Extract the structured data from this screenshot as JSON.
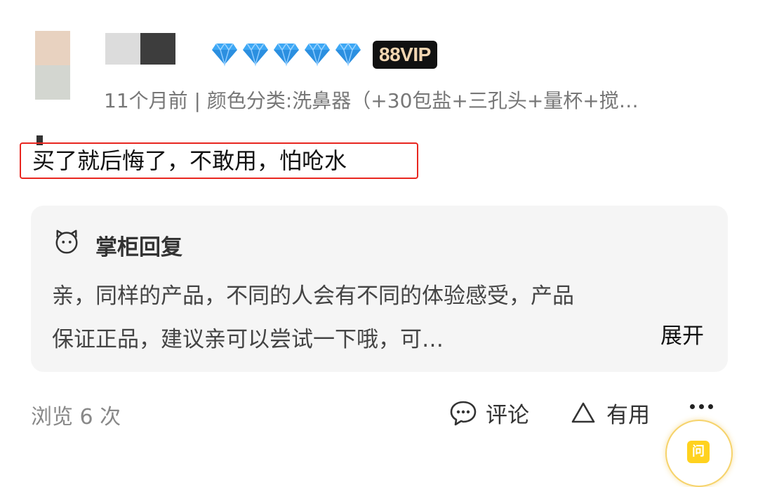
{
  "reviewer": {
    "diamond_count": 5,
    "diamond_color": "#3ea8f5",
    "vip_badge": "88VIP",
    "meta": "11个月前 | 颜色分类:洗鼻器（+30包盐+三孔头+量杯+搅…"
  },
  "review": {
    "text": "买了就后悔了，不敢用，怕呛水",
    "highlight_color": "#e8261f"
  },
  "seller_reply": {
    "icon": "smiley-face-icon",
    "title": "掌柜回复",
    "line1": "亲，同样的产品，不同的人会有不同的体验感受，产品",
    "line2": "保证正品，建议亲可以尝试一下哦，可…",
    "expand": "展开"
  },
  "footer": {
    "views": "浏览 6 次",
    "comment_icon": "chat-bubble-icon",
    "comment_label": "评论",
    "useful_icon": "triangle-thumb-icon",
    "useful_label": "有用",
    "more_icon": "more-dots-icon"
  },
  "floating": {
    "icon": "ask-icon",
    "label": "问"
  }
}
